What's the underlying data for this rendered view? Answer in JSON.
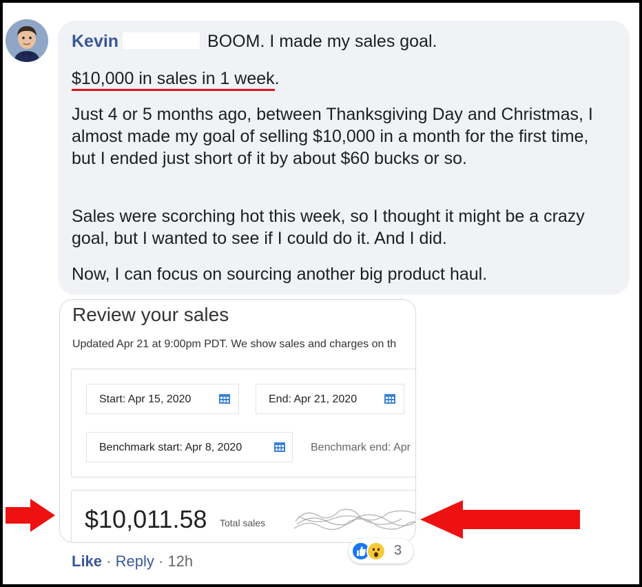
{
  "comment": {
    "author": "Kevin",
    "first_line": "BOOM. I made my sales goal.",
    "highlight": "$10,000 in sales in 1 week",
    "highlight_end": ".",
    "paragraph_1": "Just 4 or 5 months ago, between Thanksgiving Day and Christmas, I almost made my goal of selling $10,000 in a month for the first time, but I ended just short of it by about $60 bucks or so.",
    "paragraph_2": "Sales were scorching hot this week, so I thought it might be a crazy goal, but I wanted to see if I could do it. And I did.",
    "paragraph_3": "Now, I can focus on sourcing another big product haul."
  },
  "screenshot": {
    "title": "Review your sales",
    "updated": "Updated Apr 21 at 9:00pm PDT. We show sales and charges on th",
    "start": "Start: Apr 15, 2020",
    "end": "End: Apr 21, 2020",
    "benchmark_start": "Benchmark start: Apr 8, 2020",
    "benchmark_end": "Benchmark end: Apr",
    "total_value": "$10,011.58",
    "total_label": "Total sales"
  },
  "actions": {
    "like": "Like",
    "separator": "·",
    "reply": "Reply",
    "time": "12h"
  },
  "reactions": {
    "count": "3",
    "icons": [
      "like-icon",
      "wow-icon"
    ]
  },
  "colors": {
    "author": "#385898",
    "highlight_underline": "#e0101a",
    "arrow": "#ee1111",
    "bubble": "#f0f2f5"
  }
}
